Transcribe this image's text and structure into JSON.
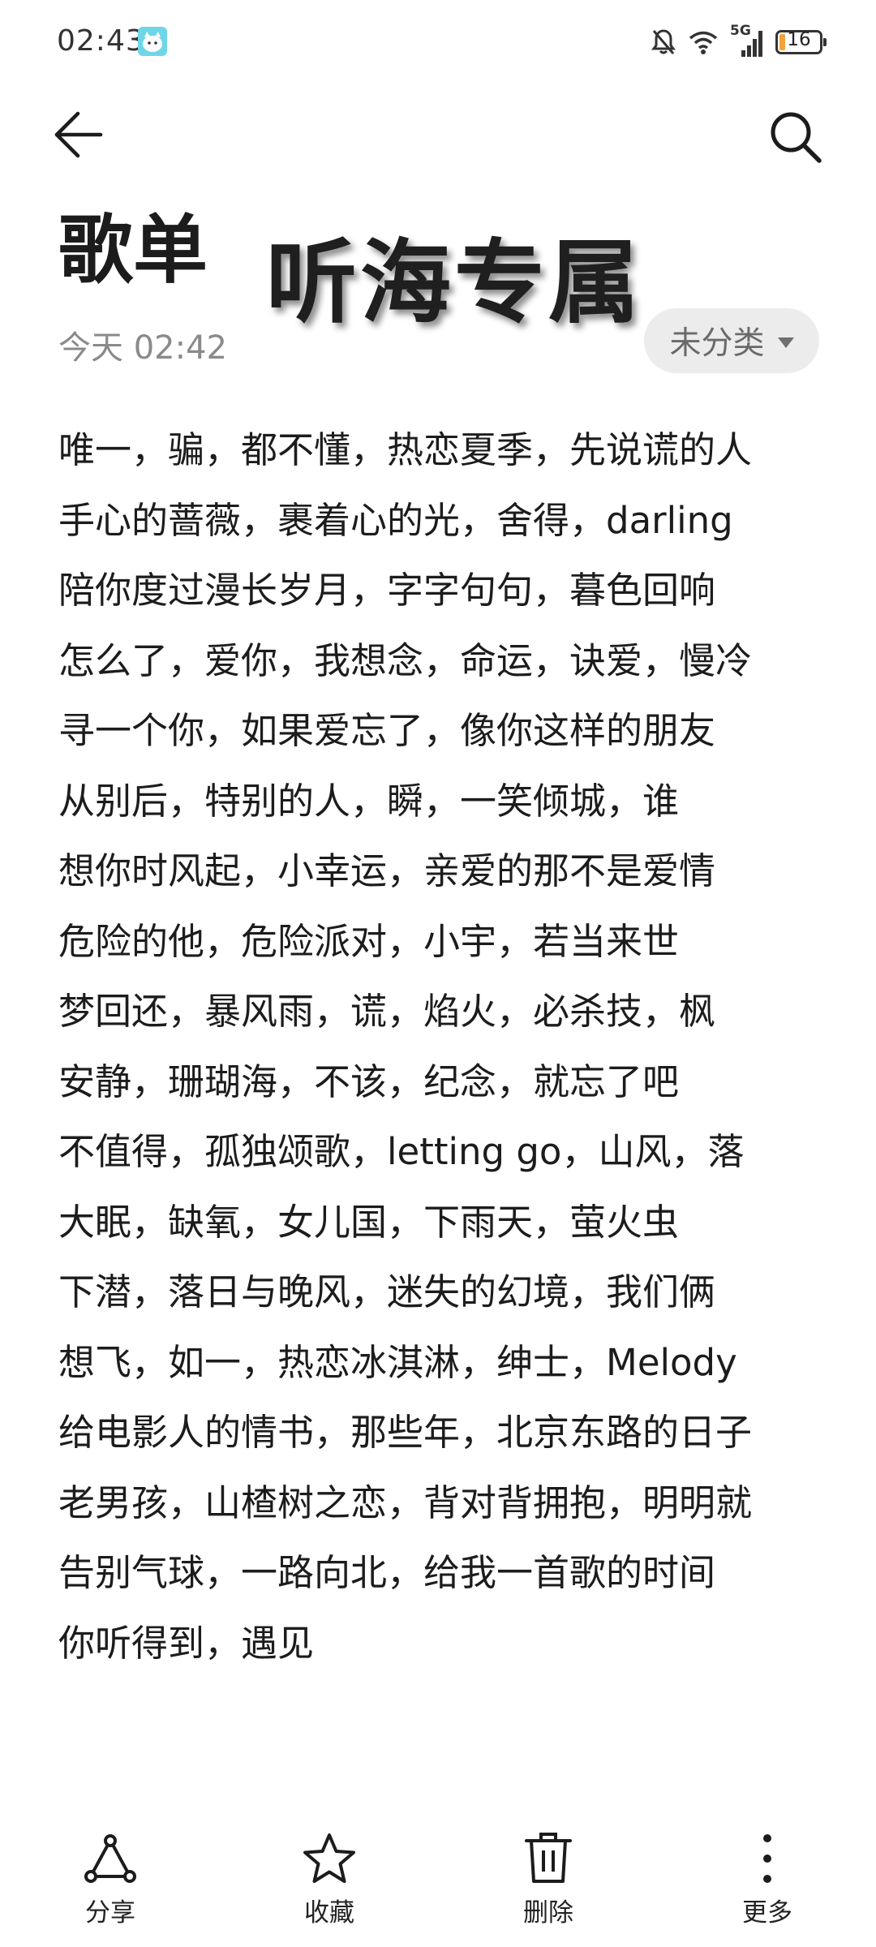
{
  "status_bar": {
    "time": "02:43",
    "network": "5G",
    "battery": "16",
    "battery_color": "#f2a33a"
  },
  "header": {
    "back_icon": "arrow-left-icon",
    "search_icon": "search-icon"
  },
  "note": {
    "title": "歌单",
    "overlay_title": "听海专属",
    "timestamp": "今天 02:42",
    "category": "未分类",
    "lines": [
      "唯一，骗，都不懂，热恋夏季，先说谎的人",
      "手心的蔷薇，裹着心的光，舍得，darling",
      "陪你度过漫长岁月，字字句句，暮色回响",
      "怎么了，爱你，我想念，命运，诀爱，慢冷",
      "寻一个你，如果爱忘了，像你这样的朋友",
      "从别后，特别的人，瞬，一笑倾城，谁",
      "想你时风起，小幸运，亲爱的那不是爱情",
      "危险的他，危险派对，小宇，若当来世",
      "梦回还，暴风雨，谎，焰火，必杀技，枫",
      "安静，珊瑚海，不该，纪念，就忘了吧",
      "不值得，孤独颂歌，letting go，山风，落",
      "大眠，缺氧，女儿国，下雨天，萤火虫",
      "下潜，落日与晚风，迷失的幻境，我们俩",
      "想飞，如一，热恋冰淇淋，绅士，Melody",
      "给电影人的情书，那些年，北京东路的日子",
      "老男孩，山楂树之恋，背对背拥抱，明明就",
      "告别气球，一路向北，给我一首歌的时间",
      "你听得到，遇见"
    ]
  },
  "bottom_bar": {
    "share": "分享",
    "favorite": "收藏",
    "delete": "删除",
    "more": "更多"
  }
}
